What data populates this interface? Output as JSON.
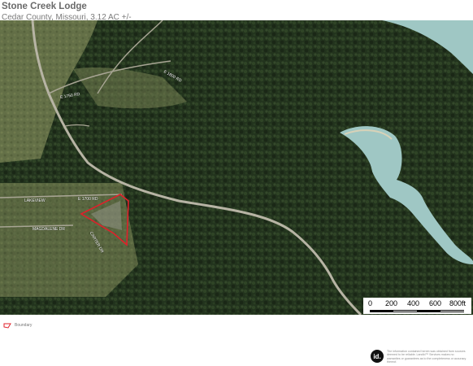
{
  "header": {
    "title": "Stone Creek Lodge",
    "subtitle": "Cedar County, Missouri, 3.12 AC +/-"
  },
  "map": {
    "road_labels": [
      "E 1700 RD",
      "LAKEVIEW",
      "MAGDALENE DR",
      "CARTER DR",
      "E 1800 RD",
      "E 1750 RD"
    ],
    "property_boundary_color": "#e0202a",
    "water_color": "#9fc7c4"
  },
  "scale": {
    "ticks": [
      "0",
      "200",
      "400",
      "600",
      "800ft"
    ]
  },
  "legend": {
    "label": "Boundary",
    "color": "#e0202a"
  },
  "footer": {
    "logo_text": "id.",
    "disclaimer": "The information contained herein was obtained from sources deemed to be reliable. LandId™ Services makes no warranties or guarantees as to the completeness or accuracy thereof."
  }
}
